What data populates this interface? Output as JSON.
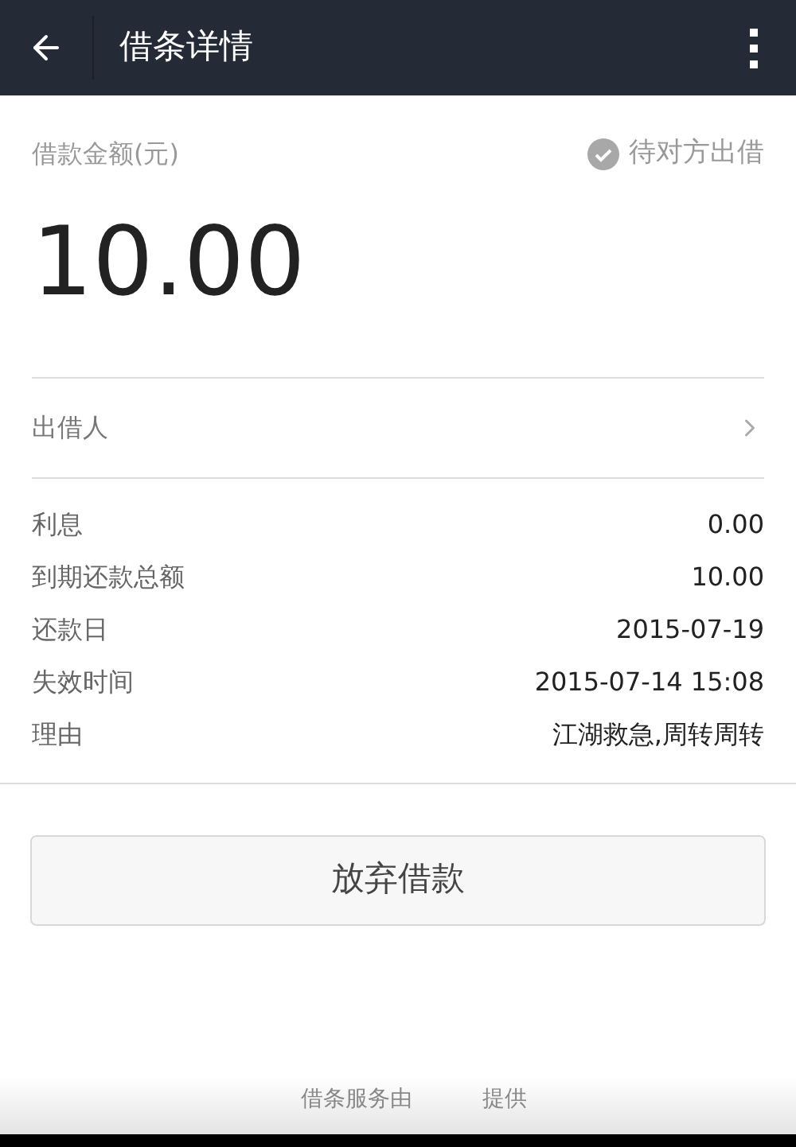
{
  "header": {
    "title": "借条详情"
  },
  "amount_label": "借款金额(元)",
  "status": {
    "text": "待对方出借",
    "done": true
  },
  "amount": "10.00",
  "lender": {
    "label": "出借人"
  },
  "details": [
    {
      "label": "利息",
      "value": "0.00"
    },
    {
      "label": "到期还款总额",
      "value": "10.00"
    },
    {
      "label": "还款日",
      "value": "2015-07-19"
    },
    {
      "label": "失效时间",
      "value": "2015-07-14 15:08"
    },
    {
      "label": "理由",
      "value": "江湖救急,周转周转"
    }
  ],
  "action_button": "放弃借款",
  "footer": [
    "借条服务由",
    "提供"
  ]
}
